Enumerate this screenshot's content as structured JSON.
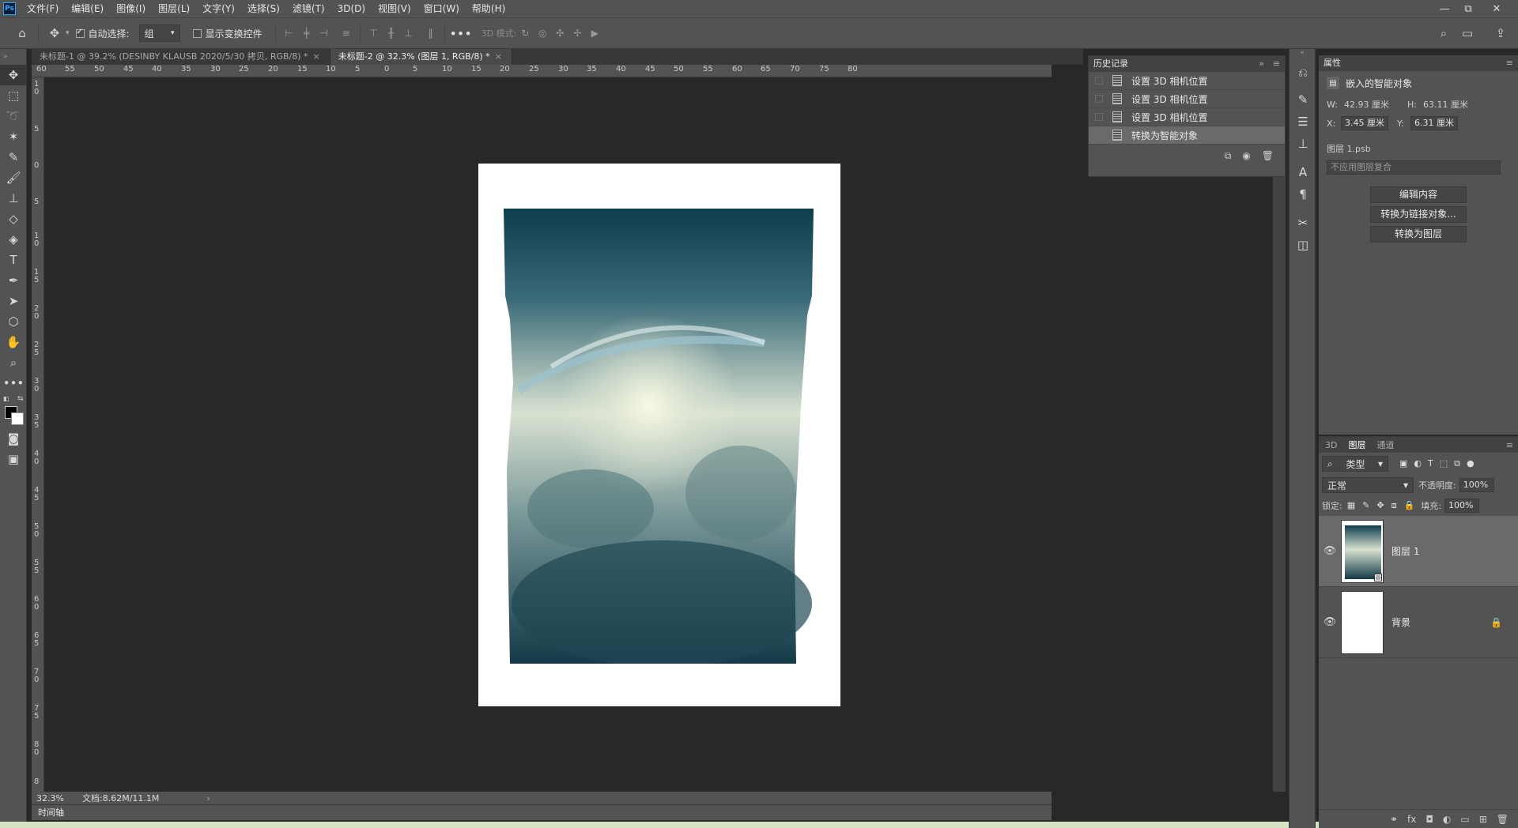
{
  "app": {
    "logo": "Ps",
    "menus": [
      "文件(F)",
      "编辑(E)",
      "图像(I)",
      "图层(L)",
      "文字(Y)",
      "选择(S)",
      "滤镜(T)",
      "3D(D)",
      "视图(V)",
      "窗口(W)",
      "帮助(H)"
    ],
    "window_controls": {
      "minimize": "—",
      "restore": "⧉",
      "close": "✕"
    }
  },
  "options_bar": {
    "auto_select_label": "自动选择:",
    "auto_select_value": "组",
    "show_transform_label": "显示变换控件",
    "mode_3d_label": "3D 模式:"
  },
  "tabs": [
    {
      "label": "未标题-1 @ 39.2% (DESINBY KLAUSB    2020/5/30 拷贝, RGB/8) *",
      "active": false
    },
    {
      "label": "未标题-2 @ 32.3% (图层 1, RGB/8) *",
      "active": true
    }
  ],
  "rulers": {
    "horizontal": [
      "60",
      "55",
      "50",
      "45",
      "40",
      "35",
      "30",
      "25",
      "20",
      "15",
      "10",
      "5",
      "0",
      "5",
      "10",
      "15",
      "20",
      "25",
      "30",
      "35",
      "40",
      "45",
      "50",
      "55",
      "60",
      "65",
      "70",
      "75",
      "80"
    ],
    "vertical": [
      "1\n0",
      "5",
      "0",
      "5",
      "1\n0",
      "1\n5",
      "2\n0",
      "2\n5",
      "3\n0",
      "3\n5",
      "4\n0",
      "4\n5",
      "5\n0",
      "5\n5",
      "6\n0",
      "6\n5",
      "7\n0",
      "7\n5",
      "8\n0",
      "8"
    ]
  },
  "status": {
    "zoom": "32.3%",
    "doc_info": "文档:8.62M/11.1M",
    "timeline_label": "时间轴"
  },
  "history": {
    "title": "历史记录",
    "items": [
      {
        "label": "设置 3D 相机位置",
        "selected": false
      },
      {
        "label": "设置 3D 相机位置",
        "selected": false
      },
      {
        "label": "设置 3D 相机位置",
        "selected": false
      },
      {
        "label": "转换为智能对象",
        "selected": true
      }
    ]
  },
  "properties": {
    "title": "属性",
    "type_label": "嵌入的智能对象",
    "w_label": "W:",
    "w_value": "42.93 厘米",
    "h_label": "H:",
    "h_value": "63.11 厘米",
    "x_label": "X:",
    "x_value": "3.45 厘米",
    "y_label": "Y:",
    "y_value": "6.31 厘米",
    "file_label": "图层 1.psb",
    "comp_placeholder": "不应用图层复合",
    "buttons": [
      "编辑内容",
      "转换为链接对象...",
      "转换为图层"
    ]
  },
  "layers_panel": {
    "tabs": [
      "3D",
      "图层",
      "通道"
    ],
    "filter_value": "类型",
    "blend_mode": "正常",
    "opacity_label": "不透明度:",
    "opacity_value": "100%",
    "lock_label": "锁定:",
    "fill_label": "填充:",
    "fill_value": "100%",
    "layers": [
      {
        "name": "图层 1",
        "selected": true
      },
      {
        "name": "背景",
        "selected": false
      }
    ]
  }
}
